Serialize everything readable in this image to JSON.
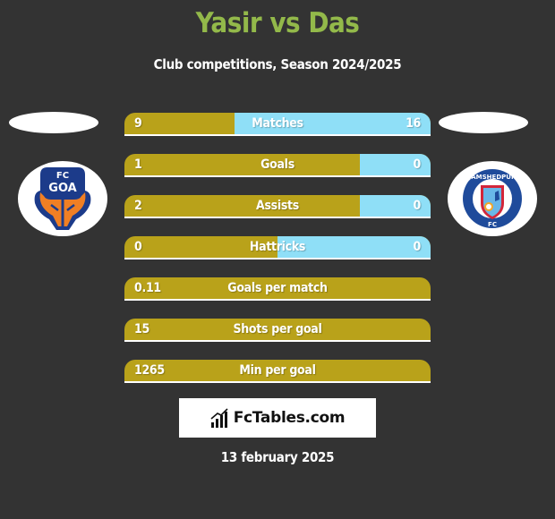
{
  "header": {
    "title": "Yasir vs Das",
    "subtitle": "Club competitions, Season 2024/2025"
  },
  "teams": {
    "left": {
      "name": "FC Goa",
      "logo_line1": "FC",
      "logo_line2": "GOA"
    },
    "right": {
      "name": "Jamshedpur FC",
      "logo_ring_text": "JAMSHEDPUR",
      "logo_bottom_text": "FC"
    }
  },
  "colors": {
    "title": "#93b94a",
    "left_bar": "#b9a21a",
    "right_bar": "#8fdff7",
    "background": "#333333"
  },
  "stats": [
    {
      "label": "Matches",
      "left": "9",
      "right": "16",
      "right_share": 0.64
    },
    {
      "label": "Goals",
      "left": "1",
      "right": "0",
      "right_share": 0.23
    },
    {
      "label": "Assists",
      "left": "2",
      "right": "0",
      "right_share": 0.23
    },
    {
      "label": "Hattricks",
      "left": "0",
      "right": "0",
      "right_share": 0.5
    },
    {
      "label": "Goals per match",
      "left": "0.11",
      "right": "",
      "right_share": 0
    },
    {
      "label": "Shots per goal",
      "left": "15",
      "right": "",
      "right_share": 0
    },
    {
      "label": "Min per goal",
      "left": "1265",
      "right": "",
      "right_share": 0
    }
  ],
  "brand": {
    "text": "FcTables.com",
    "icon": "bar-chart-icon"
  },
  "footer": {
    "date": "13 february 2025"
  }
}
